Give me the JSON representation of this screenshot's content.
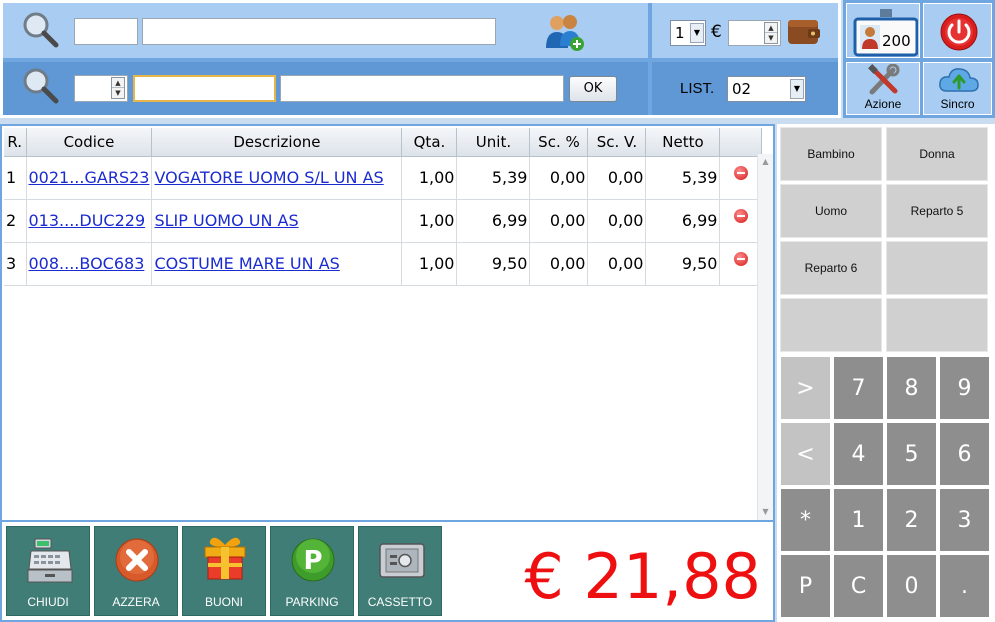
{
  "search": {
    "customer_code_value": "",
    "customer_name_value": "",
    "article_qty_value": "",
    "article_code_value": "",
    "article_desc_value": "",
    "ok_label": "OK"
  },
  "payment": {
    "count_value": "1",
    "currency_symbol": "€",
    "amount_value": "",
    "list_label": "LIST.",
    "list_value": "02"
  },
  "operator": {
    "badge_number": "200"
  },
  "toolbar": {
    "azione_label": "Azione",
    "sincro_label": "Sincro"
  },
  "table": {
    "headers": [
      "R.",
      "Codice",
      "Descrizione",
      "Qta.",
      "Unit.",
      "Sc. %",
      "Sc. V.",
      "Netto"
    ],
    "rows": [
      {
        "r": "1",
        "codice": "0021...GARS23",
        "descrizione": "VOGATORE UOMO S/L UN AS",
        "qta": "1,00",
        "unit": "5,39",
        "sc_pct": "0,00",
        "sc_v": "0,00",
        "netto": "5,39"
      },
      {
        "r": "2",
        "codice": "013....DUC229",
        "descrizione": "SLIP UOMO UN AS",
        "qta": "1,00",
        "unit": "6,99",
        "sc_pct": "0,00",
        "sc_v": "0,00",
        "netto": "6,99"
      },
      {
        "r": "3",
        "codice": "008....BOC683",
        "descrizione": "COSTUME MARE UN AS",
        "qta": "1,00",
        "unit": "9,50",
        "sc_pct": "0,00",
        "sc_v": "0,00",
        "netto": "9,50"
      }
    ]
  },
  "actions": [
    "CHIUDI",
    "AZZERA",
    "BUONI",
    "PARKING",
    "CASSETTO"
  ],
  "total": "€ 21,88",
  "categories": [
    "Bambino",
    "Donna",
    "Uomo",
    "Reparto 5",
    "Reparto 6",
    "",
    "",
    ""
  ],
  "keypad": [
    ">",
    "7",
    "8",
    "9",
    "<",
    "4",
    "5",
    "6",
    "*",
    "1",
    "2",
    "3",
    "P",
    "C",
    "0",
    "."
  ],
  "colors": {
    "panel_blue": "#6fa6df",
    "action_teal": "#3f7d76",
    "total_red": "#ee1010",
    "link_blue": "#1a2bd0"
  }
}
